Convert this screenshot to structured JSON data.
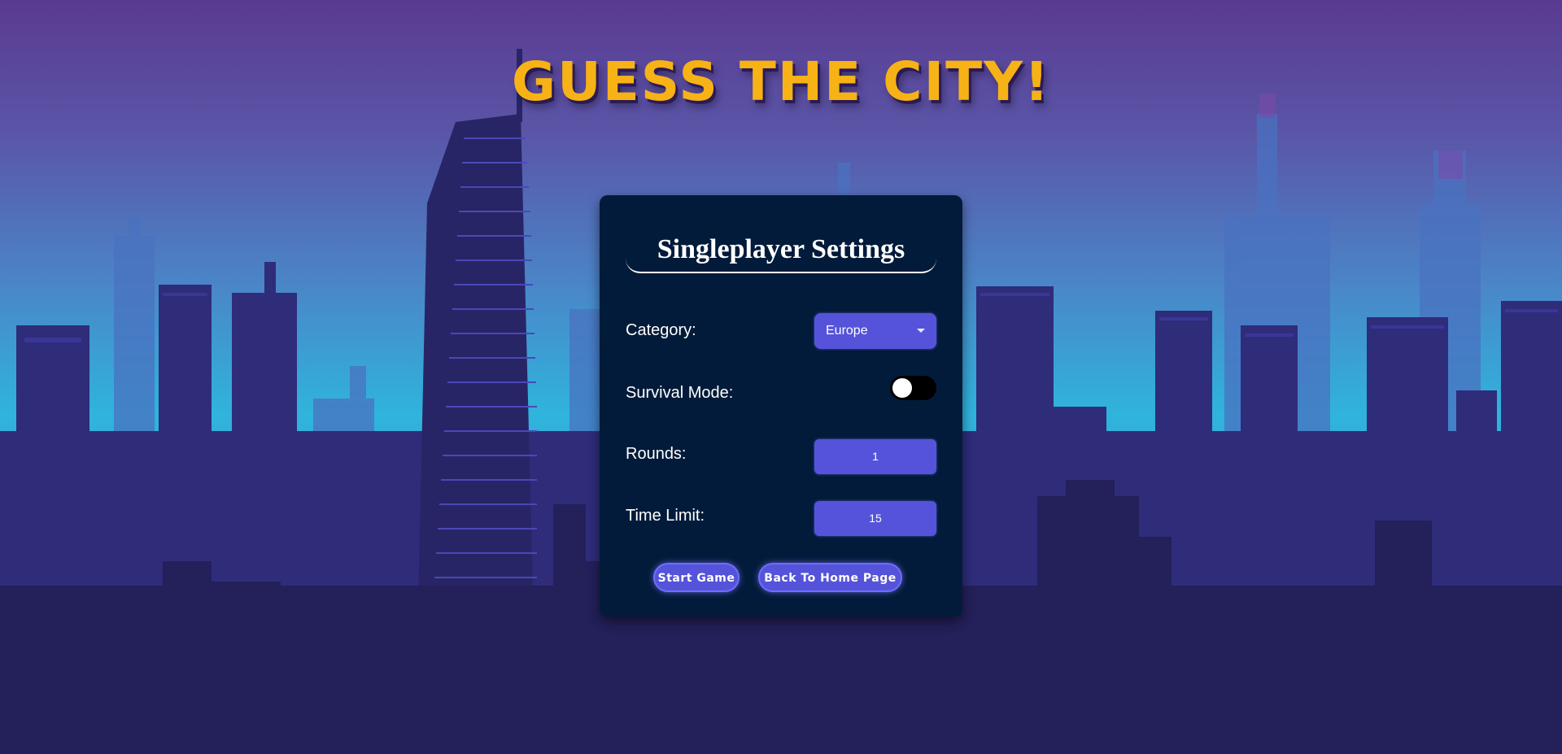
{
  "title": "GUESS THE CITY!",
  "settings_panel": {
    "heading": "Singleplayer Settings",
    "category": {
      "label": "Category:",
      "selected": "Europe"
    },
    "survival_mode": {
      "label": "Survival Mode:",
      "enabled": false
    },
    "rounds": {
      "label": "Rounds:",
      "value": "1"
    },
    "time_limit": {
      "label": "Time Limit:",
      "value": "15"
    },
    "buttons": {
      "start": "Start Game",
      "back": "Back To Home Page"
    }
  },
  "colors": {
    "title": "#f7b215",
    "panel": "#031b3a",
    "accent": "#5553d9"
  }
}
